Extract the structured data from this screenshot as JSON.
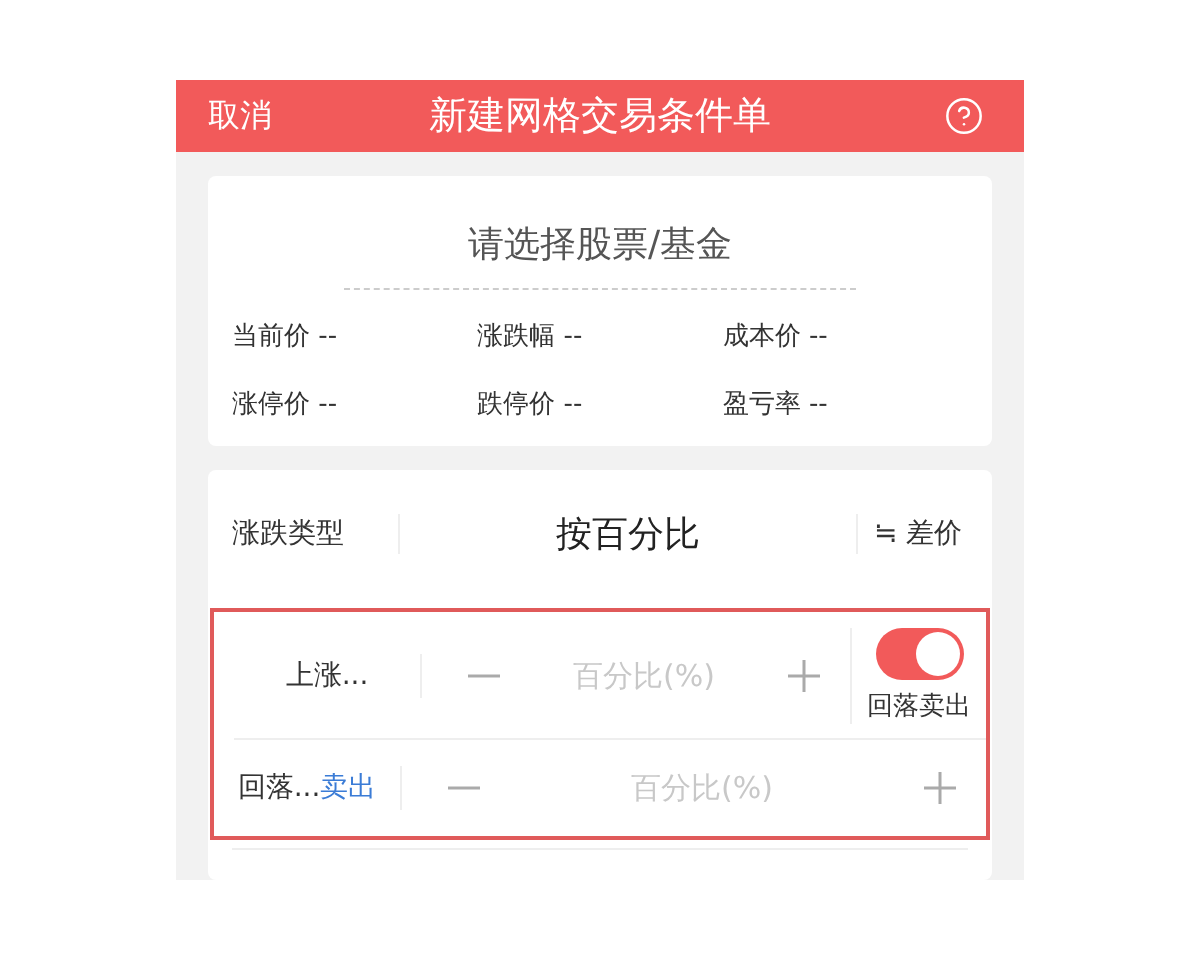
{
  "header": {
    "cancel": "取消",
    "title": "新建网格交易条件单"
  },
  "stock": {
    "placeholder": "请选择股票/基金"
  },
  "stats": [
    "当前价 --",
    "涨跌幅 --",
    "成本价 --",
    "涨停价 --",
    "跌停价 --",
    "盈亏率 --"
  ],
  "type_row": {
    "label": "涨跌类型",
    "value": "按百分比",
    "switch_label": "≒ 差价"
  },
  "rules": [
    {
      "kind": "toggle",
      "label": "上涨...",
      "placeholder": "百分比(%)",
      "toggle": {
        "on": true,
        "label": "回落卖出"
      }
    },
    {
      "kind": "plain",
      "label": "回落...",
      "link": "卖出",
      "placeholder": "百分比(%)"
    }
  ]
}
